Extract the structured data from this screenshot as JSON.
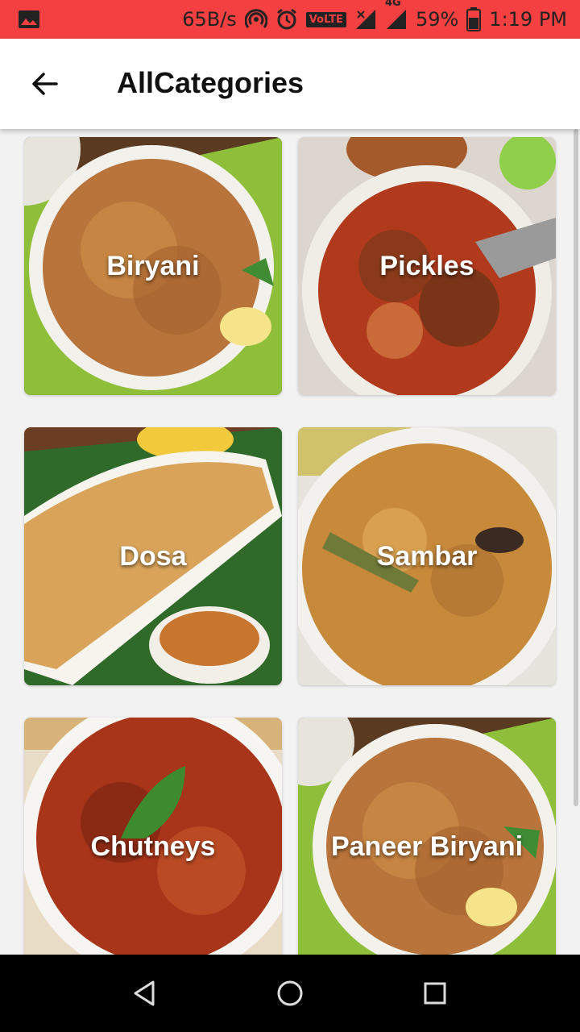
{
  "status_bar": {
    "speed": "65B/s",
    "volte": "VoLTE",
    "network": "4G",
    "battery": "59%",
    "time": "1:19 PM"
  },
  "app_bar": {
    "title": "AllCategories"
  },
  "categories": [
    {
      "label": "Biryani"
    },
    {
      "label": "Pickles"
    },
    {
      "label": "Dosa"
    },
    {
      "label": "Sambar"
    },
    {
      "label": "Chutneys"
    },
    {
      "label": "Paneer Biryani"
    }
  ],
  "colors": {
    "status_bar": "#f44040",
    "app_bar": "#ffffff",
    "background": "#f2f2f2",
    "nav_bar": "#000000"
  }
}
